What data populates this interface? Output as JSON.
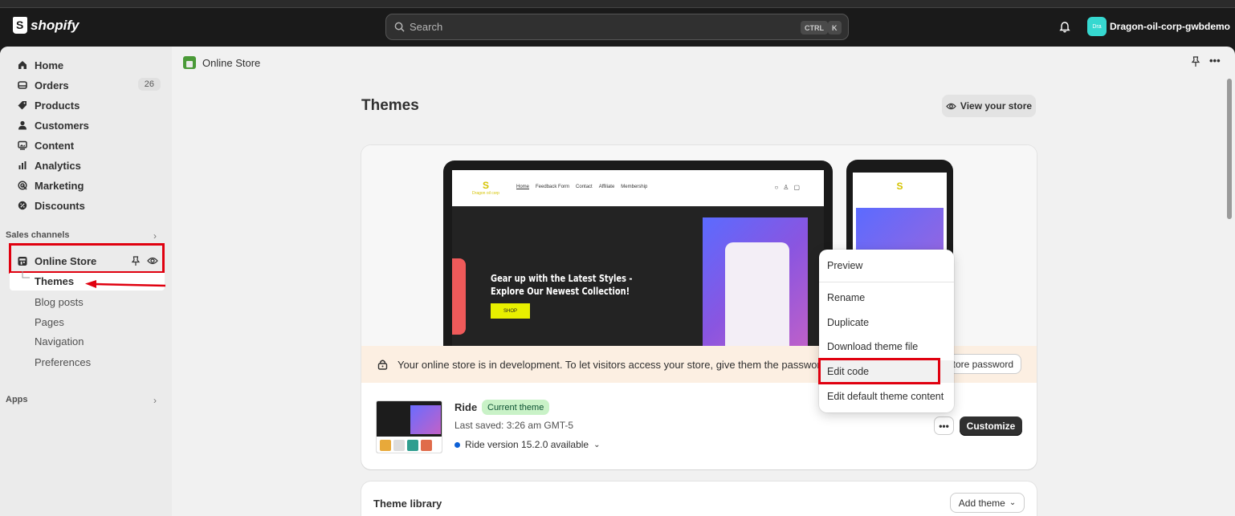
{
  "topbar": {
    "logo_text": "shopify",
    "search_placeholder": "Search",
    "kbd_ctrl": "CTRL",
    "kbd_k": "K",
    "avatar_initials": "Dra",
    "store_name": "Dragon-oil-corp-gwbdemo"
  },
  "sidebar": {
    "items": [
      {
        "label": "Home",
        "icon": "home-icon"
      },
      {
        "label": "Orders",
        "icon": "inbox-icon",
        "count": "26"
      },
      {
        "label": "Products",
        "icon": "tag-icon"
      },
      {
        "label": "Customers",
        "icon": "person-icon"
      },
      {
        "label": "Content",
        "icon": "image-icon"
      },
      {
        "label": "Analytics",
        "icon": "bar-chart-icon"
      },
      {
        "label": "Marketing",
        "icon": "target-icon"
      },
      {
        "label": "Discounts",
        "icon": "discount-icon"
      }
    ],
    "sales_channels_label": "Sales channels",
    "online_store_label": "Online Store",
    "sub_items": [
      "Themes",
      "Blog posts",
      "Pages",
      "Navigation",
      "Preferences"
    ],
    "apps_label": "Apps"
  },
  "breadcrumb": {
    "label": "Online Store"
  },
  "page": {
    "title": "Themes",
    "view_store_label": "View your store"
  },
  "preview": {
    "nav_links": [
      "Home",
      "Feedback Form",
      "Contact",
      "Affiliate",
      "Membership"
    ],
    "hero_heading": "Gear up with the Latest Styles - Explore Our Newest Collection!",
    "hero_button": "SHOP"
  },
  "dev_banner": {
    "text": "Your online store is in development. To let visitors access your store, give them the password.",
    "button_label": "tore password"
  },
  "current_theme": {
    "name": "Ride",
    "badge": "Current theme",
    "last_saved": "Last saved: 3:26 am GMT-5",
    "version_text": "Ride version 15.2.0 available",
    "more_label": "•••",
    "customize_label": "Customize"
  },
  "actions_menu": {
    "items": [
      "Preview",
      "Rename",
      "Duplicate",
      "Download theme file",
      "Edit code",
      "Edit default theme content"
    ]
  },
  "theme_library": {
    "title": "Theme library",
    "add_button": "Add theme"
  },
  "colors": {
    "accent_highlight": "#e0000f",
    "badge_green": "#c9f2c7",
    "avatar": "#36d8d0"
  }
}
